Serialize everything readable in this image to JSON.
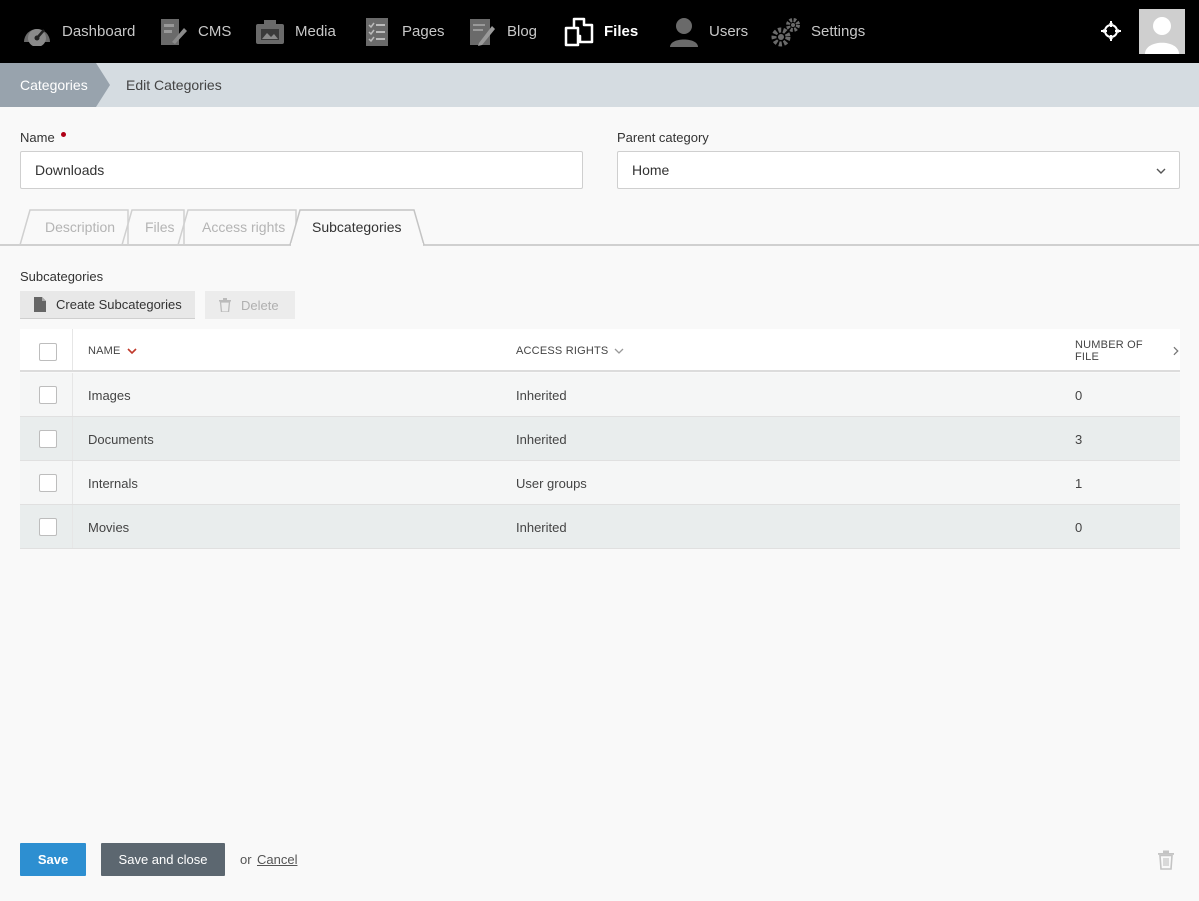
{
  "nav": {
    "items": [
      {
        "label": "Dashboard",
        "icon": "dashboard-gauge-icon",
        "active": false
      },
      {
        "label": "CMS",
        "icon": "cms-icon",
        "active": false
      },
      {
        "label": "Media",
        "icon": "media-camera-icon",
        "active": false
      },
      {
        "label": "Pages",
        "icon": "pages-checklist-icon",
        "active": false
      },
      {
        "label": "Blog",
        "icon": "blog-pencil-icon",
        "active": false
      },
      {
        "label": "Files",
        "icon": "files-icon",
        "active": true
      },
      {
        "label": "Users",
        "icon": "user-icon",
        "active": false
      },
      {
        "label": "Settings",
        "icon": "gears-icon",
        "active": false
      }
    ]
  },
  "breadcrumb": {
    "root": "Categories",
    "current": "Edit Categories"
  },
  "form": {
    "name_label": "Name",
    "name_value": "Downloads",
    "parent_label": "Parent category",
    "parent_value": "Home"
  },
  "tabs": {
    "description": "Description",
    "files": "Files",
    "access_rights": "Access rights",
    "subcategories": "Subcategories",
    "active": "subcategories"
  },
  "subcategories": {
    "section_label": "Subcategories",
    "create_label": "Create Subcategories",
    "delete_label": "Delete",
    "columns": {
      "name": "NAME",
      "access": "ACCESS RIGHTS",
      "files": "NUMBER OF FILE"
    },
    "rows": [
      {
        "name": "Images",
        "access": "Inherited",
        "files": "0"
      },
      {
        "name": "Documents",
        "access": "Inherited",
        "files": "3"
      },
      {
        "name": "Internals",
        "access": "User groups",
        "files": "1"
      },
      {
        "name": "Movies",
        "access": "Inherited",
        "files": "0"
      }
    ]
  },
  "footer": {
    "save_label": "Save",
    "save_close_label": "Save and close",
    "or_text": "or",
    "cancel_label": "Cancel"
  },
  "colors": {
    "primary": "#2d8fd1",
    "secondary": "#5c6770",
    "required": "#b00016",
    "sort_accent": "#c0392b"
  }
}
